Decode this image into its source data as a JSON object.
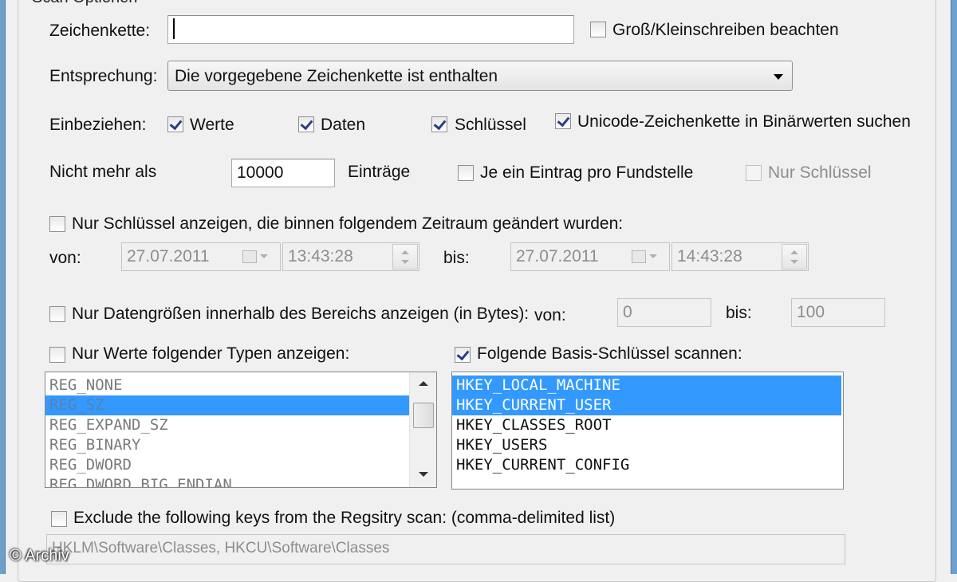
{
  "group": {
    "title": "Scan Optionen"
  },
  "search": {
    "label": "Zeichenkette:",
    "value": "",
    "case_label": "Groß/Kleinschreiben beachten",
    "case_checked": false
  },
  "match": {
    "label": "Entsprechung:",
    "selected": "Die vorgegebene Zeichenkette ist enthalten"
  },
  "include": {
    "label": "Einbeziehen:",
    "values": {
      "label": "Werte",
      "checked": true
    },
    "data": {
      "label": "Daten",
      "checked": true
    },
    "keys": {
      "label": "Schlüssel",
      "checked": true
    },
    "unicode": {
      "label": "Unicode-Zeichenkette in Binärwerten suchen",
      "checked": true
    }
  },
  "limit": {
    "label": "Nicht mehr als",
    "value": "10000",
    "unit": "Einträge",
    "one_per_label": "Je ein Eintrag pro Fundstelle",
    "one_per_checked": false,
    "keys_only_label": "Nur Schlüssel",
    "keys_only_checked": false
  },
  "timerange": {
    "check_label": "Nur Schlüssel anzeigen, die binnen folgendem Zeitraum geändert wurden:",
    "checked": false,
    "from_label": "von:",
    "from_date": "27.07.2011",
    "from_time": "13:43:28",
    "to_label": "bis:",
    "to_date": "27.07.2011",
    "to_time": "14:43:28"
  },
  "datasize": {
    "check_label": "Nur Datengrößen innerhalb des Bereichs anzeigen (in Bytes):",
    "checked": false,
    "from_label": "von:",
    "from_value": "0",
    "to_label": "bis:",
    "to_value": "100"
  },
  "types": {
    "check_label": "Nur Werte folgender Typen anzeigen:",
    "checked": false,
    "items": [
      "REG_NONE",
      "REG_SZ",
      "REG_EXPAND_SZ",
      "REG_BINARY",
      "REG_DWORD",
      "REG_DWORD_BIG_ENDIAN"
    ],
    "selected_index": 1
  },
  "basekeys": {
    "check_label": "Folgende Basis-Schlüssel scannen:",
    "checked": true,
    "items": [
      "HKEY_LOCAL_MACHINE",
      "HKEY_CURRENT_USER",
      "HKEY_CLASSES_ROOT",
      "HKEY_USERS",
      "HKEY_CURRENT_CONFIG"
    ],
    "selected_indices": [
      0,
      1
    ]
  },
  "exclude": {
    "check_label": "Exclude the following keys from the Regsitry scan: (comma-delimited list)",
    "checked": false,
    "value": "HKLM\\Software\\Classes, HKCU\\Software\\Classes"
  },
  "watermark": "© Archiv",
  "colors": {
    "selection": "#3399ff",
    "window_frame": "#6fa0c9",
    "background": "#f0f0f0"
  }
}
